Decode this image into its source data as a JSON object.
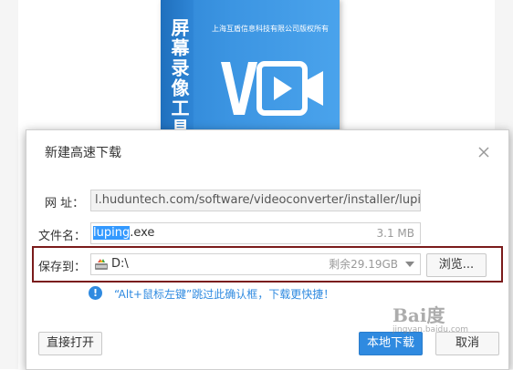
{
  "background": {
    "product_box": {
      "title": "屏幕录像工具",
      "company": "上海互盾信息科技有限公司版权所有",
      "logo": "video-camera-logo-icon",
      "color": "#3a92e0"
    }
  },
  "dialog": {
    "title": "新建高速下载",
    "close_icon": "close-icon",
    "url": {
      "label": "网  址：",
      "value": "l.huduntech.com/software/videoconverter/installer/luping.exe"
    },
    "filename": {
      "label": "文件名：",
      "name_selected": "luping",
      "name_ext": ".exe",
      "size": "3.1 MB"
    },
    "save_to": {
      "label": "保存到：",
      "drive_icon": "drive-icon",
      "path": "D:\\",
      "free_space": "剩余29.19GB",
      "browse_label": "浏览..."
    },
    "tip": {
      "icon": "info-icon",
      "text": "“Alt+鼠标左键”跳过此确认框，下载更快捷！"
    },
    "buttons": {
      "open_direct": "直接打开",
      "local_download": "本地下载",
      "cancel": "取消"
    },
    "accent_color": "#2f8ae0",
    "highlight_border_color": "#7a1b1b"
  },
  "watermark": {
    "main": "Bai度",
    "sub": "jingyan.baidu.com"
  }
}
